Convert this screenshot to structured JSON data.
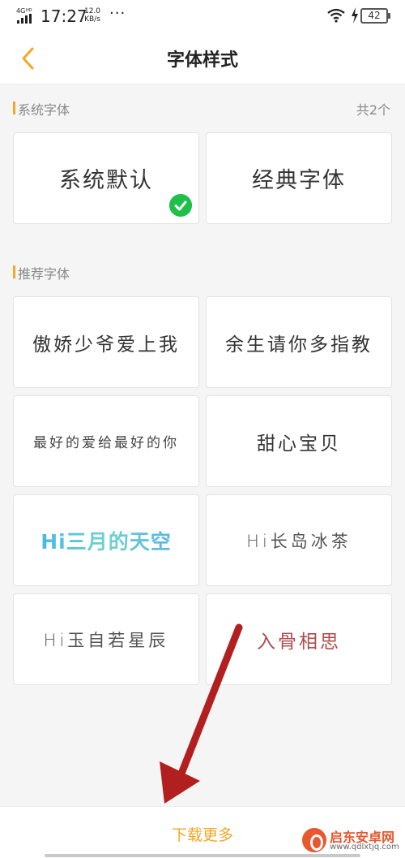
{
  "status_bar": {
    "network": "4G HD",
    "time": "17:27",
    "speed_value": "12.0",
    "speed_unit": "KB/s",
    "more": "···",
    "battery": "42"
  },
  "nav": {
    "title": "字体样式"
  },
  "system_section": {
    "label": "系统字体",
    "count": "共2个",
    "fonts": [
      {
        "name": "系统默认",
        "selected": true
      },
      {
        "name": "经典字体",
        "selected": false
      }
    ]
  },
  "recommended_section": {
    "label": "推荐字体",
    "fonts": [
      {
        "name": "傲娇少爷爱上我"
      },
      {
        "name": "余生请你多指教"
      },
      {
        "name": "最好的爱给最好的你"
      },
      {
        "name": "甜心宝贝"
      },
      {
        "name": "Hi三月的天空"
      },
      {
        "name": "Hi长岛冰茶"
      },
      {
        "name": "Hi玉自若星辰"
      },
      {
        "name": "入骨相思"
      }
    ]
  },
  "bottom": {
    "download_more": "下载更多"
  },
  "watermark": {
    "name": "启东安卓网",
    "url": "www.qdlxtjq.com"
  },
  "colors": {
    "accent": "#f5a623",
    "check": "#1fbf4a",
    "annotation_arrow": "#b21f1f"
  }
}
